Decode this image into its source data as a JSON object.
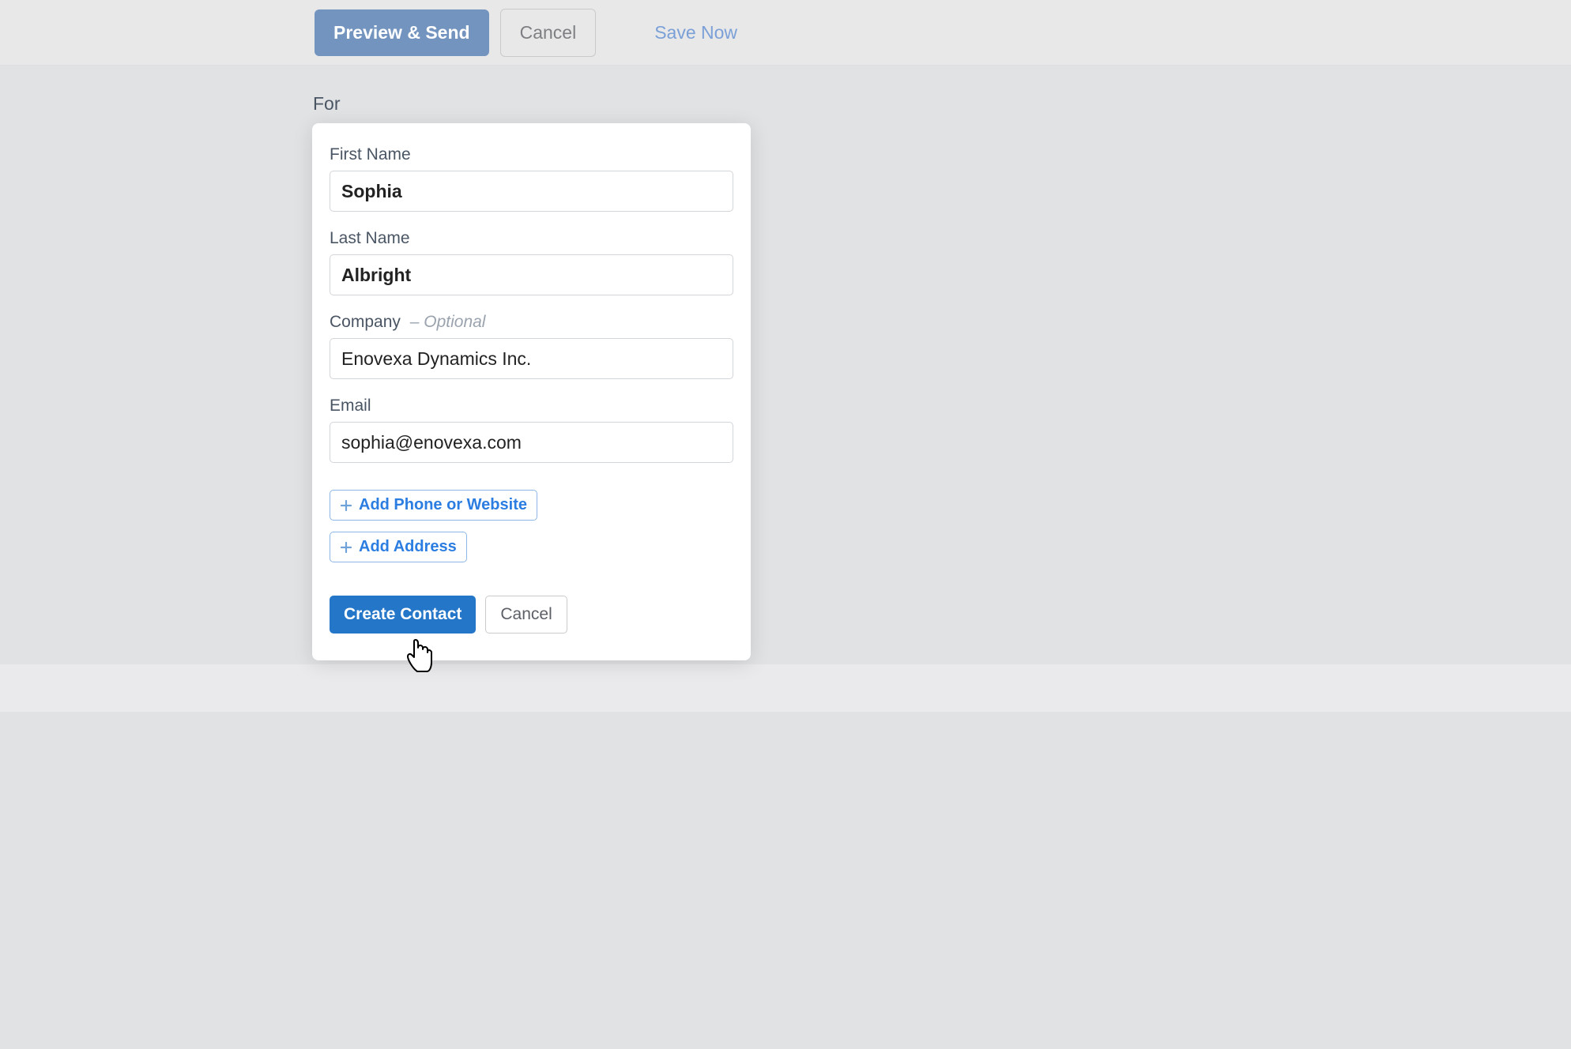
{
  "topbar": {
    "preview_send_label": "Preview & Send",
    "cancel_label": "Cancel",
    "save_now_label": "Save Now"
  },
  "page": {
    "for_label": "For"
  },
  "form": {
    "first_name": {
      "label": "First Name",
      "value": "Sophia"
    },
    "last_name": {
      "label": "Last Name",
      "value": "Albright"
    },
    "company": {
      "label": "Company",
      "optional_hint": "– Optional",
      "value": "Enovexa Dynamics Inc."
    },
    "email": {
      "label": "Email",
      "value": "sophia@enovexa.com"
    },
    "add_phone_website_label": "Add Phone or Website",
    "add_address_label": "Add Address",
    "create_contact_label": "Create Contact",
    "cancel_label": "Cancel"
  }
}
